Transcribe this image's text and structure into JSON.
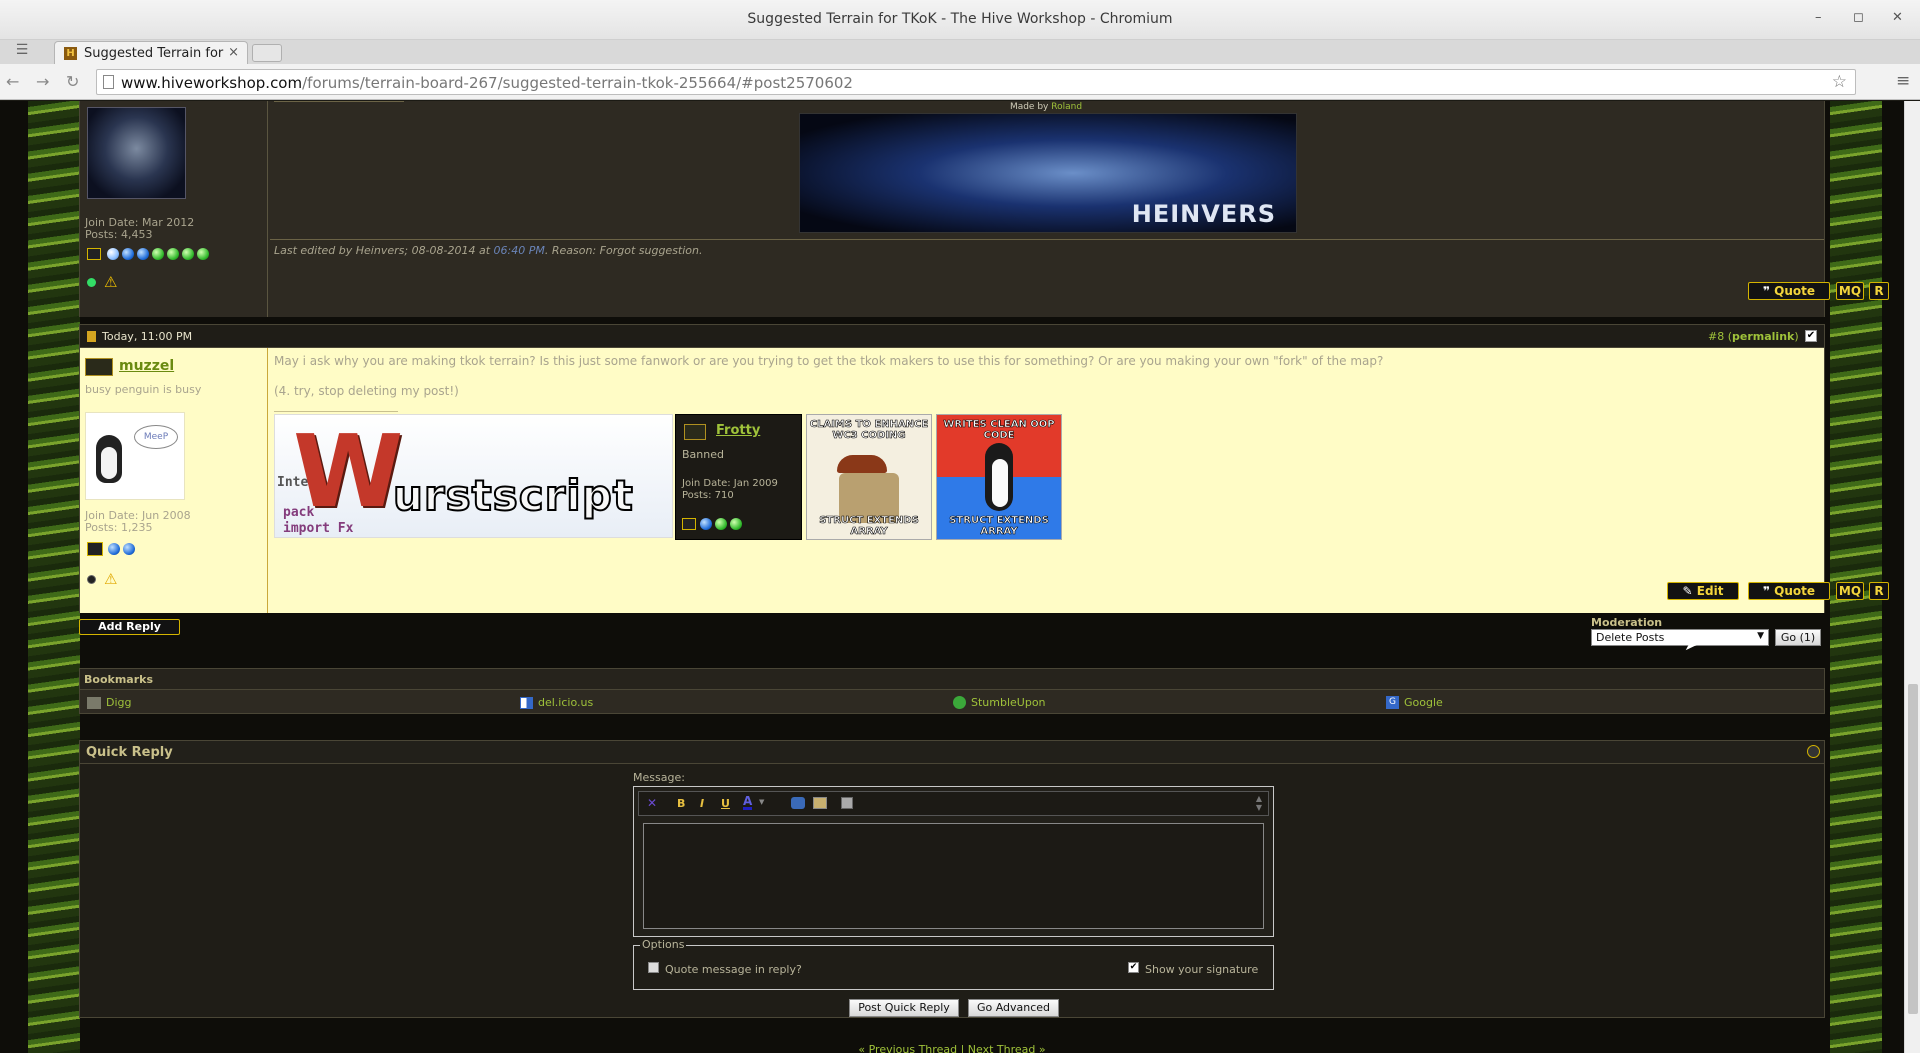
{
  "window": {
    "title": "Suggested Terrain for TKoK - The Hive Workshop - Chromium",
    "minimize": "–",
    "maximize": "◻",
    "close": "✕"
  },
  "tab": {
    "label": "Suggested Terrain for",
    "close": "×",
    "favicon": "H"
  },
  "address": {
    "domain": "www.hiveworkshop.com",
    "path": "/forums/terrain-board-267/suggested-terrain-tkok-255664/#post2570602",
    "back": "←",
    "forward": "→",
    "reload": "↻",
    "star": "☆",
    "menu": "≡"
  },
  "post7": {
    "join_date": "Join Date: Mar 2012",
    "posts": "Posts: 4,453",
    "made_by": "Made by",
    "made_by_name": "Roland",
    "banner_text": "HEINVERS",
    "edited_prefix": "Last edited by Heinvers; 08-08-2014 at ",
    "edited_time": "06:40 PM",
    ". Reason": "",
    "edited_reason": ". Reason: Forgot suggestion.",
    "buttons": {
      "quote": "Quote",
      "mq": "MQ",
      "r": "R"
    }
  },
  "post8": {
    "date": "Today, 11:00 PM",
    "number_prefix": "#",
    "number": "8",
    "permalink": "permalink",
    "username": "muzzel",
    "user_title": "busy penguin is busy",
    "avatar_bubble": "MeeP",
    "join_date": "Join Date: Jun 2008",
    "posts": "Posts: 1,235",
    "message_line1": "May i ask why you are making tkok terrain? Is this just some fanwork or are you trying to get the tkok makers to use this for something? Or are you making your own \"fork\" of the map?",
    "message_line2": "(4. try, stop deleting my post!)",
    "sig_wurst_text": "urstscript",
    "sig_wurst_letter": "W",
    "sig_code1": "Inte",
    "sig_code2": "pack",
    "sig_code3": "import Fx",
    "frotty": {
      "name": "Frotty",
      "title": "Banned",
      "join_date": "Join Date: Jan 2009",
      "posts": "Posts: 710"
    },
    "meme1_top": "CLAIMS TO ENHANCE WC3 CODING",
    "meme1_bottom": "STRUCT EXTENDS ARRAY",
    "meme2_top": "WRITES CLEAN OOP CODE",
    "meme2_bottom": "STRUCT EXTENDS ARRAY",
    "buttons": {
      "edit": "Edit",
      "quote": "Quote",
      "mq": "MQ",
      "r": "R"
    }
  },
  "thread_tools": {
    "add_reply": "Add Reply",
    "moderation_label": "Moderation",
    "moderation_selected": "Delete Posts",
    "go": "Go (1)"
  },
  "bookmarks": {
    "title": "Bookmarks",
    "items": [
      "Digg",
      "del.icio.us",
      "StumbleUpon",
      "Google"
    ]
  },
  "quick_reply": {
    "title": "Quick Reply",
    "message_label": "Message:",
    "toolbar": {
      "remove_format": "✕",
      "bold": "B",
      "italic": "I",
      "underline": "U",
      "color": "A"
    },
    "options_legend": "Options",
    "quote_option": "Quote message in reply?",
    "signature_option": "Show your signature",
    "post_button": "Post Quick Reply",
    "advanced_button": "Go Advanced"
  },
  "thread_nav": {
    "open": "«",
    "previous": "Previous Thread",
    "sep": "|",
    "next": "Next Thread",
    "close": "»"
  }
}
